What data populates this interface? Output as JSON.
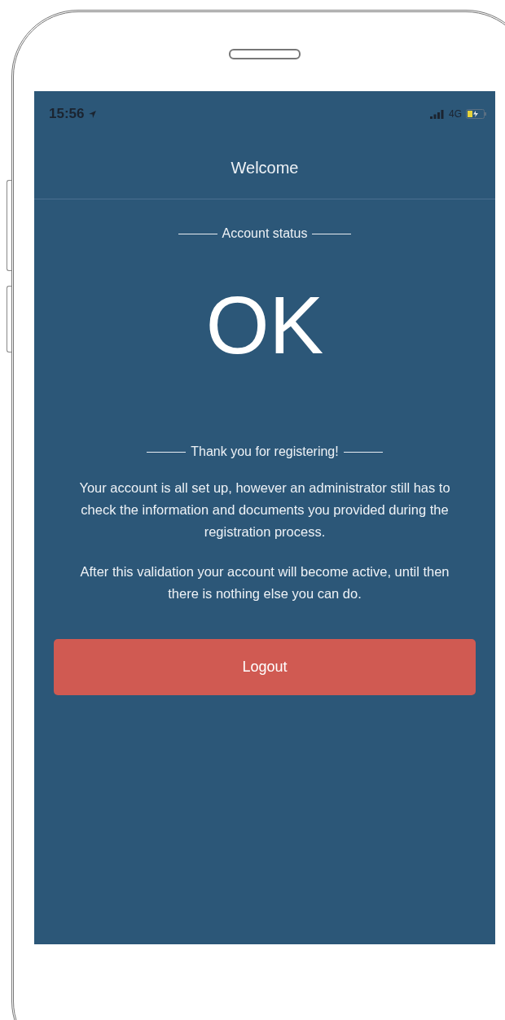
{
  "status_bar": {
    "time": "15:56",
    "network": "4G"
  },
  "header": {
    "title": "Welcome"
  },
  "account_status": {
    "label": "Account status",
    "value": "OK"
  },
  "message": {
    "heading": "Thank you for registering!",
    "paragraphs": [
      "Your account is all set up, however an administrator still has to check the information and documents you provided during the registration process.",
      "After this validation your account will become active, until then there is nothing else you can do."
    ]
  },
  "logout_button": {
    "label": "Logout"
  }
}
